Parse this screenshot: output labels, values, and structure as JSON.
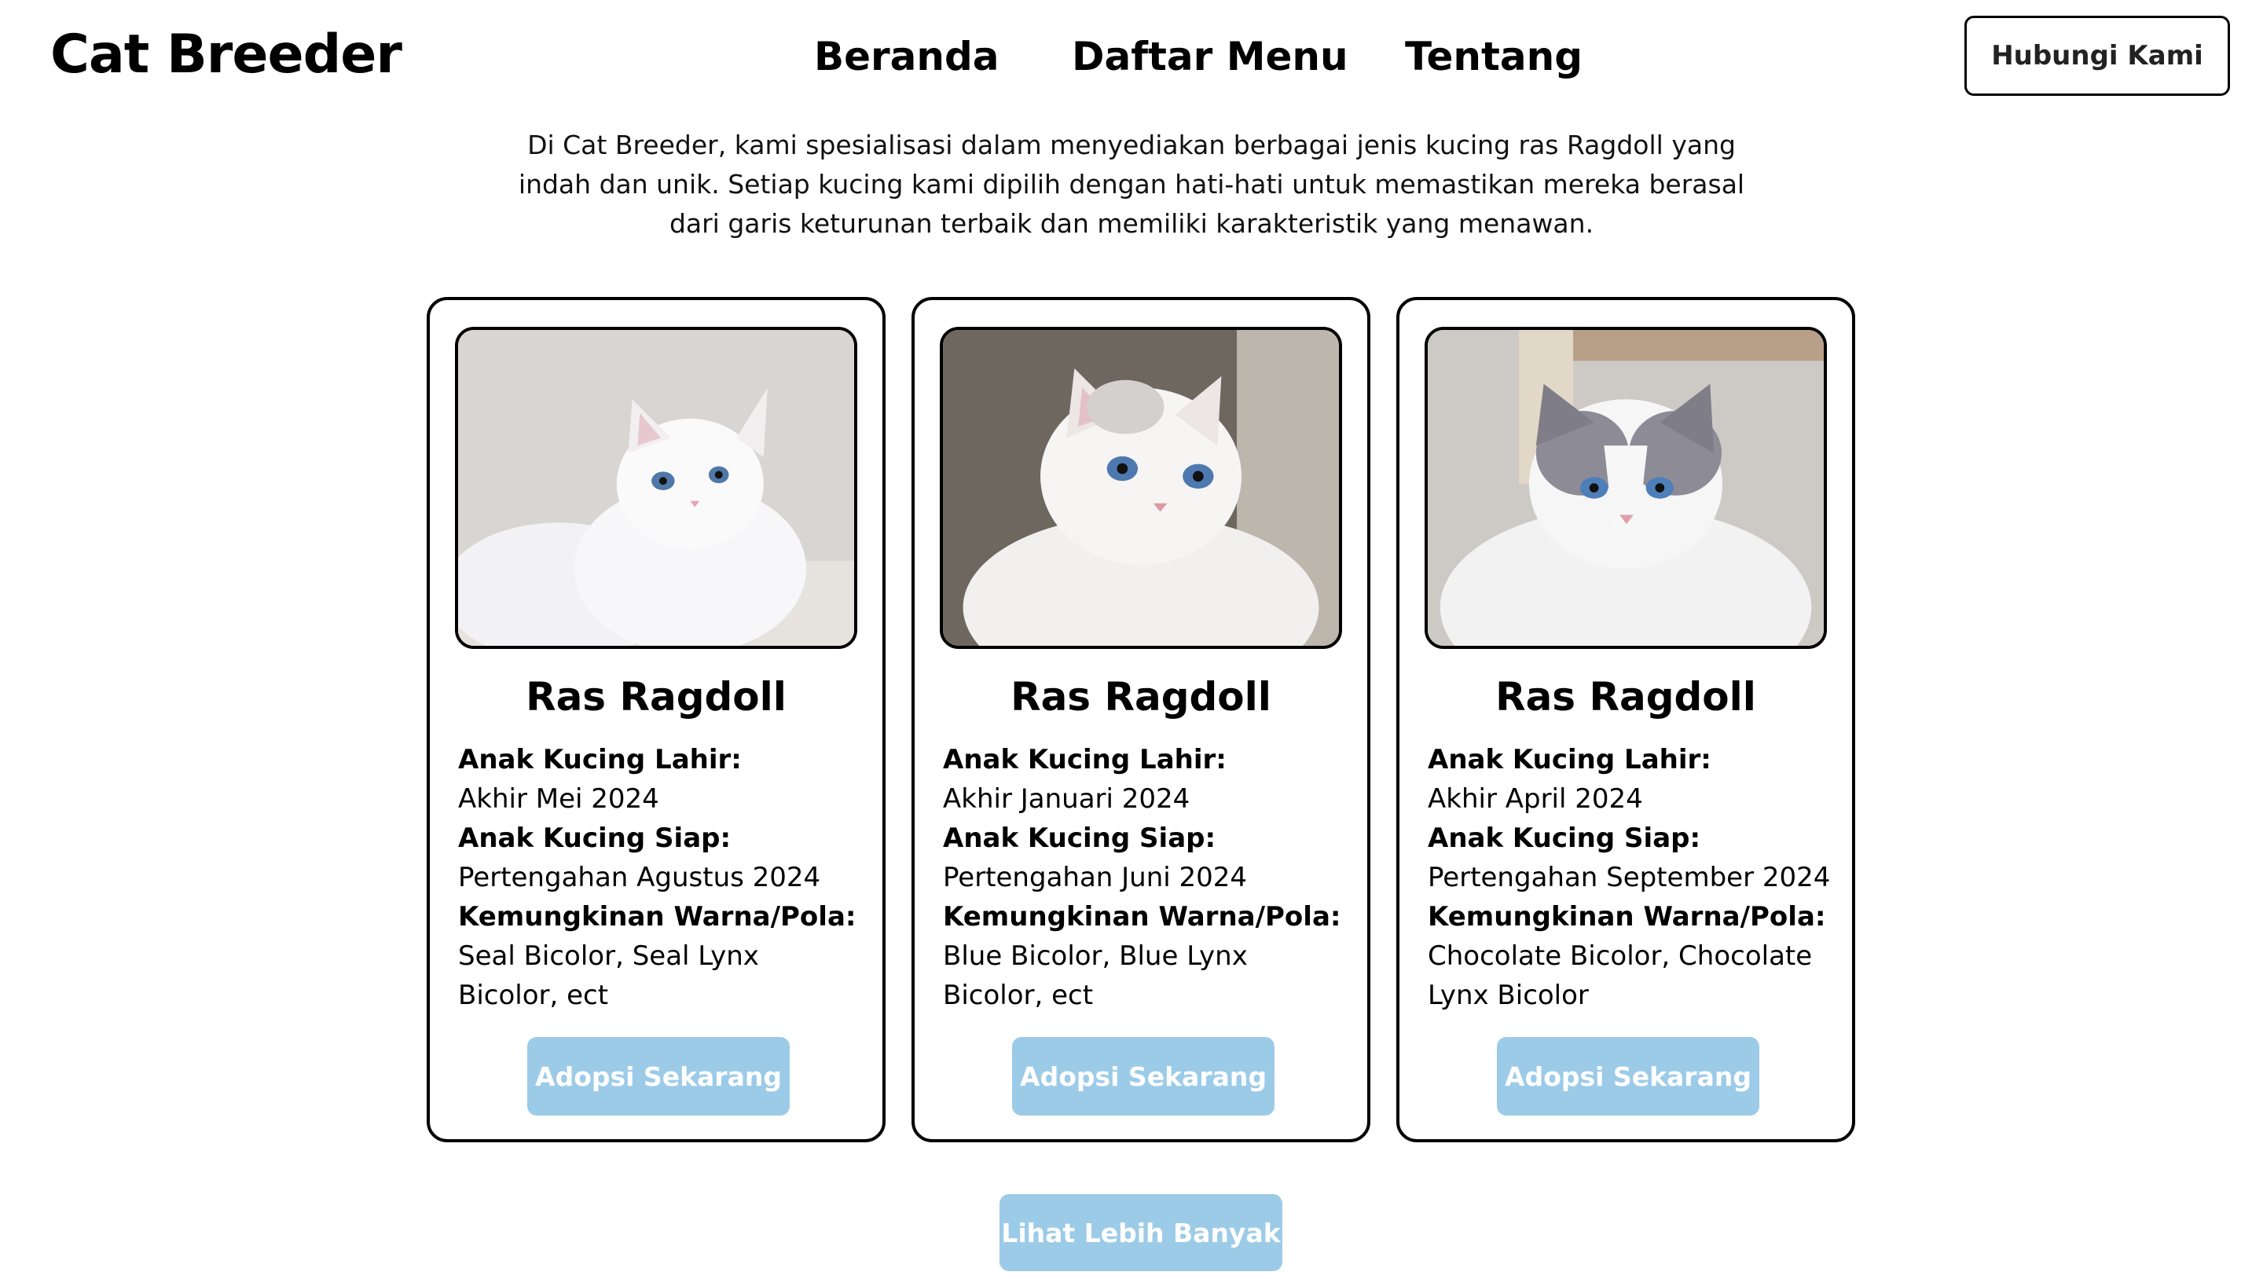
{
  "header": {
    "logo": "Cat Breeder",
    "nav": [
      "Beranda",
      "Daftar Menu",
      "Tentang"
    ],
    "contact_label": "Hubungi Kami"
  },
  "intro": {
    "lines": [
      "Di Cat Breeder, kami spesialisasi dalam menyediakan berbagai jenis kucing ras Ragdoll yang",
      "indah dan unik. Setiap kucing kami dipilih dengan hati-hati untuk memastikan mereka berasal",
      "dari garis keturunan terbaik dan memiliki karakteristik yang menawan."
    ]
  },
  "cards": [
    {
      "title": "Ras Ragdoll",
      "born_label": "Anak Kucing Lahir:",
      "born_value": "Akhir Mei 2024",
      "ready_label": "Anak Kucing Siap:",
      "ready_value": "Pertengahan Agustus 2024",
      "color_label": "Kemungkinan Warna/Pola:",
      "color_value": "Seal Bicolor, Seal Lynx Bicolor, ect",
      "adopt_label": "Adopsi Sekarang"
    },
    {
      "title": "Ras Ragdoll",
      "born_label": "Anak Kucing Lahir:",
      "born_value": "Akhir Januari 2024",
      "ready_label": "Anak Kucing Siap:",
      "ready_value": "Pertengahan Juni 2024",
      "color_label": "Kemungkinan Warna/Pola:",
      "color_value": "Blue Bicolor, Blue Lynx Bicolor, ect",
      "adopt_label": "Adopsi Sekarang"
    },
    {
      "title": "Ras Ragdoll",
      "born_label": "Anak Kucing Lahir:",
      "born_value": "Akhir April 2024",
      "ready_label": "Anak Kucing Siap:",
      "ready_value": "Pertengahan September 2024",
      "color_label": "Kemungkinan Warna/Pola:",
      "color_value": "Chocolate Bicolor, Chocolate Lynx Bicolor",
      "adopt_label": "Adopsi Sekarang"
    }
  ],
  "more_label": "Lihat Lebih Banyak",
  "colors": {
    "button_blue": "#9ccbe8",
    "border": "#000000"
  }
}
